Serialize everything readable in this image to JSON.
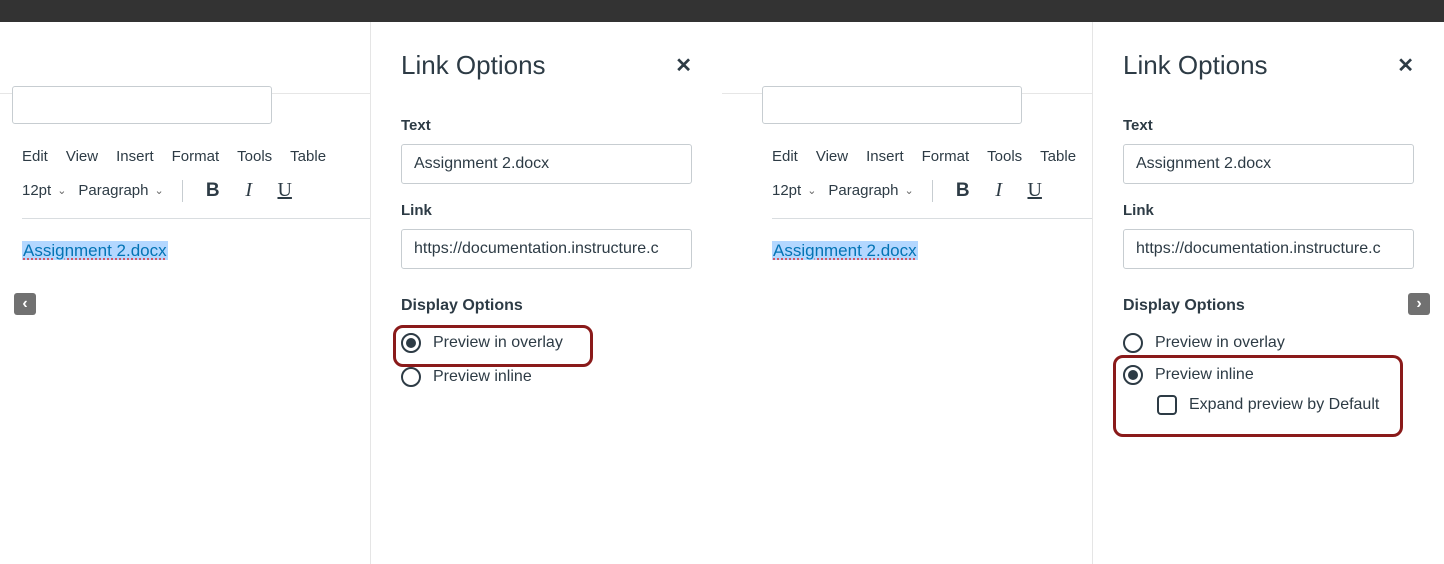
{
  "topRight": {
    "expand": "⤢",
    "close": "✕"
  },
  "nav": {
    "prev": "‹",
    "next": "›"
  },
  "editor": {
    "menu": {
      "edit": "Edit",
      "view": "View",
      "insert": "Insert",
      "format": "Format",
      "tools": "Tools",
      "table": "Table"
    },
    "fontSize": "12pt",
    "paraStyle": "Paragraph",
    "linkedFile": "Assignment 2.docx"
  },
  "panel": {
    "title": "Link Options",
    "close": "✕",
    "textLabel": "Text",
    "textValue": "Assignment 2.docx",
    "linkLabel": "Link",
    "linkValue": "https://documentation.instructure.c",
    "displayLabel": "Display Options",
    "overlay": "Preview in overlay",
    "inline": "Preview inline",
    "expandDefault": "Expand preview by Default"
  },
  "left": {
    "selectedOption": "overlay"
  },
  "right": {
    "selectedOption": "inline",
    "expandChecked": false
  }
}
